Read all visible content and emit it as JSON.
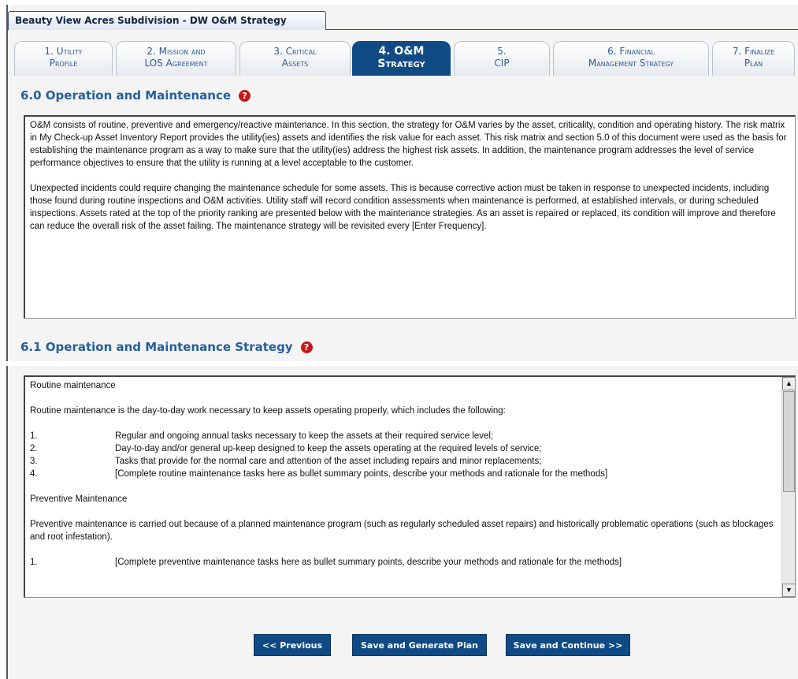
{
  "window": {
    "title": "Beauty View Acres Subdivision - DW O&M Strategy"
  },
  "tabs": [
    {
      "line1": "1. Utility",
      "line2": "Profile"
    },
    {
      "line1": "2. Mission and",
      "line2": "LOS Agreement"
    },
    {
      "line1": "3. Critical",
      "line2": "Assets"
    },
    {
      "line1": "4. O&M",
      "line2": "Strategy"
    },
    {
      "line1": "5.",
      "line2": "CIP"
    },
    {
      "line1": "6. Financial",
      "line2": "Management Strategy"
    },
    {
      "line1": "7. Finalize",
      "line2": "Plan"
    }
  ],
  "active_tab": "4. O&M Strategy",
  "section1": {
    "heading": "6.0 Operation and Maintenance",
    "help_glyph": "?",
    "paragraphs": [
      "O&M consists of routine, preventive and emergency/reactive maintenance. In this section, the strategy for O&M varies by the asset, criticality, condition and operating history. The risk matrix in My Check-up Asset Inventory Report provides the utility(ies) assets and identifies the risk value for each asset. This risk matrix and section 5.0 of this document were used as the basis for establishing the maintenance program as a way to make sure that the utility(ies) address the highest risk assets. In addition, the maintenance program addresses the level of service performance objectives to ensure that the utility is running at a level acceptable to the customer.",
      "Unexpected incidents could require changing the maintenance schedule for some assets. This is because corrective action must be taken in response to unexpected incidents, including those found during routine inspections and O&M activities. Utility staff will record condition assessments when maintenance is performed, at established intervals, or during scheduled inspections. Assets rated at the top of the priority ranking are presented below with the maintenance strategies. As an asset is repaired or replaced, its condition will improve and therefore can reduce the overall risk of the asset failing. The maintenance strategy will be revisited every [Enter Frequency]."
    ]
  },
  "section2": {
    "heading": "6.1 Operation and Maintenance Strategy",
    "help_glyph": "?",
    "routine_title": "Routine maintenance",
    "routine_intro": "Routine maintenance is the day-to-day work necessary to keep assets operating properly, which includes the following:",
    "routine_items": [
      {
        "num": "1.",
        "text": "Regular and ongoing annual tasks necessary to keep the assets at their required service level;"
      },
      {
        "num": "2.",
        "text": "Day-to-day and/or general up-keep designed to keep the assets operating at the required levels of service;"
      },
      {
        "num": "3.",
        "text": "Tasks that provide for the normal care and attention of the asset including repairs and minor replacements;"
      },
      {
        "num": "4.",
        "text": "[Complete routine maintenance tasks here as bullet summary points, describe your methods and rationale for the methods]"
      }
    ],
    "preventive_title": "Preventive Maintenance",
    "preventive_intro": "Preventive maintenance is carried out because of a planned maintenance program (such as regularly scheduled asset repairs) and historically problematic operations (such as blockages and root infestation).",
    "preventive_items": [
      {
        "num": "1.",
        "text": "[Complete preventive maintenance tasks here as bullet summary points, describe your methods and rationale for the methods]"
      }
    ],
    "scroll_up_glyph": "▲",
    "scroll_down_glyph": "▼"
  },
  "buttons": {
    "previous": "<< Previous",
    "generate": "Save and Generate Plan",
    "continue": "Save and Continue >>"
  }
}
